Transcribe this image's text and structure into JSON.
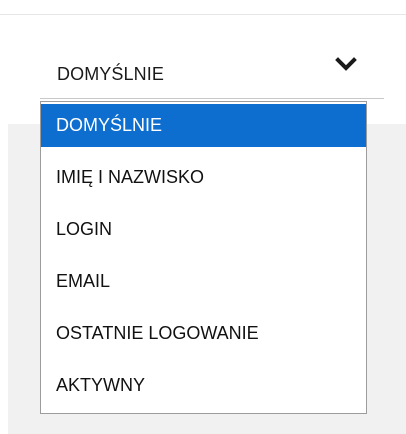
{
  "sort_select": {
    "value": "DOMYŚLNIE",
    "options": [
      {
        "label": "DOMYŚLNIE",
        "selected": true
      },
      {
        "label": "IMIĘ I NAZWISKO",
        "selected": false
      },
      {
        "label": "LOGIN",
        "selected": false
      },
      {
        "label": "EMAIL",
        "selected": false
      },
      {
        "label": "OSTATNIE LOGOWANIE",
        "selected": false
      },
      {
        "label": "AKTYWNY",
        "selected": false
      }
    ],
    "icon": "chevron-down-icon"
  },
  "colors": {
    "selected_background": "#0e6ecf",
    "selected_text": "#ffffff",
    "panel_background": "#f1f1f1"
  }
}
